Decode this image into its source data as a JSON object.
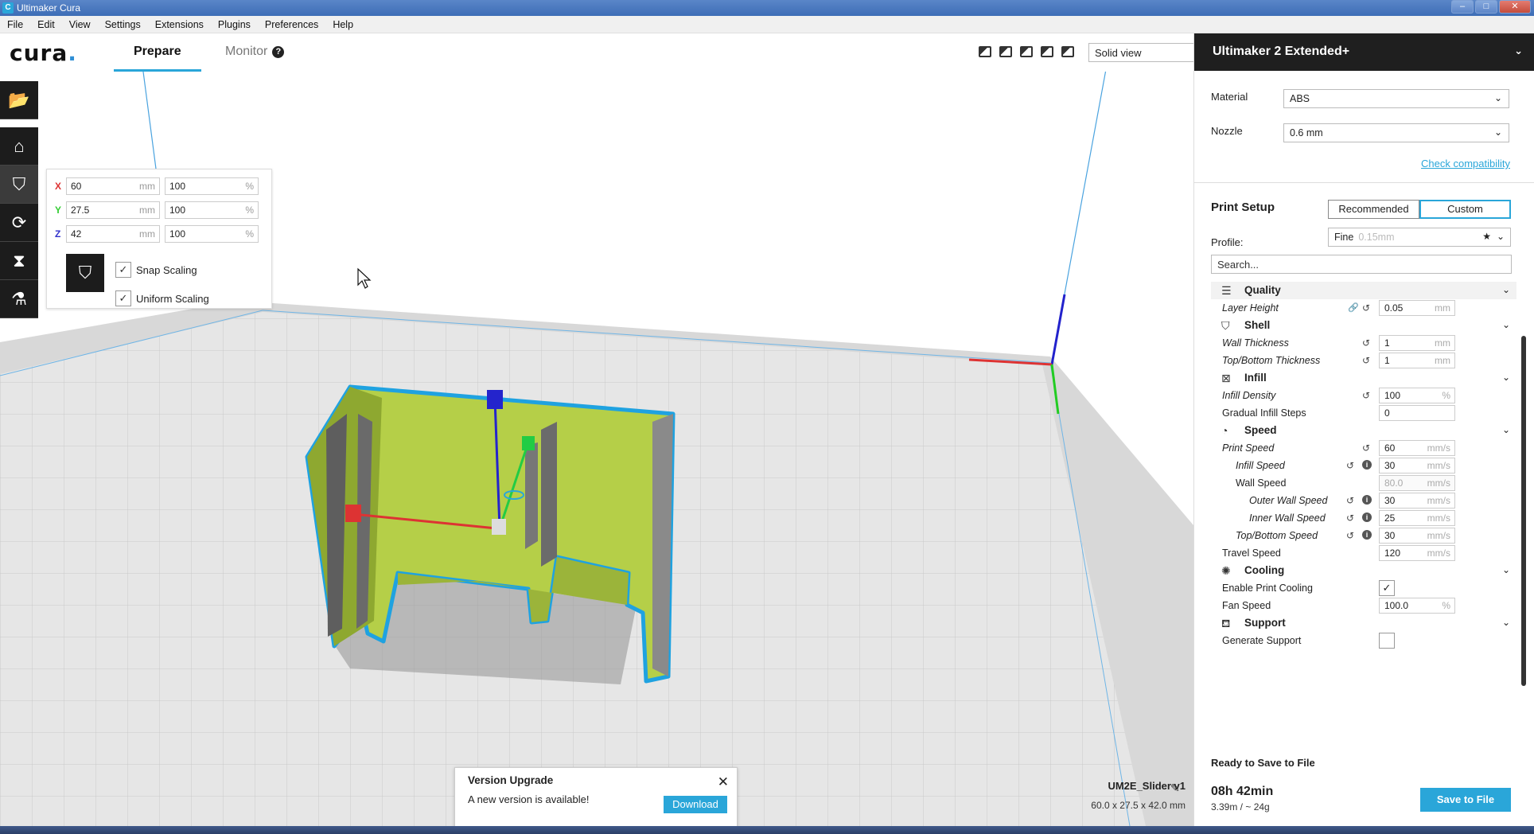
{
  "window": {
    "title": "Ultimaker Cura"
  },
  "menu": [
    "File",
    "Edit",
    "View",
    "Settings",
    "Extensions",
    "Plugins",
    "Preferences",
    "Help"
  ],
  "header": {
    "logo": "cura",
    "logo_dot": ".",
    "tabs": {
      "prepare": "Prepare",
      "monitor": "Monitor"
    },
    "monitor_help": "?",
    "view_mode": "Solid view"
  },
  "scale_panel": {
    "x": {
      "axis": "X",
      "mm": "60",
      "pct": "100"
    },
    "y": {
      "axis": "Y",
      "mm": "27.5",
      "pct": "100"
    },
    "z": {
      "axis": "Z",
      "mm": "42",
      "pct": "100"
    },
    "unit_mm": "mm",
    "unit_pct": "%",
    "snap_scaling": "Snap Scaling",
    "uniform_scaling": "Uniform Scaling"
  },
  "notification": {
    "title": "Version Upgrade",
    "message": "A new version is available!",
    "button": "Download"
  },
  "object": {
    "name": "UM2E_Slider v1",
    "dims": "60.0 x 27.5 x 42.0 mm"
  },
  "sidebar": {
    "printer": "Ultimaker 2 Extended+",
    "material_label": "Material",
    "material": "ABS",
    "nozzle_label": "Nozzle",
    "nozzle": "0.6 mm",
    "check_compat": "Check compatibility",
    "print_setup": "Print Setup",
    "mode_recommended": "Recommended",
    "mode_custom": "Custom",
    "profile_label": "Profile:",
    "profile": "Fine",
    "profile_sub": "0.15mm",
    "search_placeholder": "Search...",
    "settings": {
      "quality": "Quality",
      "layer_height": "Layer Height",
      "layer_height_val": "0.05",
      "shell": "Shell",
      "wall_thickness": "Wall Thickness",
      "wall_thickness_val": "1",
      "top_bottom_thickness": "Top/Bottom Thickness",
      "top_bottom_thickness_val": "1",
      "infill": "Infill",
      "infill_density": "Infill Density",
      "infill_density_val": "100",
      "gradual_infill": "Gradual Infill Steps",
      "gradual_infill_val": "0",
      "speed": "Speed",
      "print_speed": "Print Speed",
      "print_speed_val": "60",
      "infill_speed": "Infill Speed",
      "infill_speed_val": "30",
      "wall_speed": "Wall Speed",
      "wall_speed_val": "80.0",
      "outer_wall_speed": "Outer Wall Speed",
      "outer_wall_speed_val": "30",
      "inner_wall_speed": "Inner Wall Speed",
      "inner_wall_speed_val": "25",
      "top_bottom_speed": "Top/Bottom Speed",
      "top_bottom_speed_val": "30",
      "travel_speed": "Travel Speed",
      "travel_speed_val": "120",
      "cooling": "Cooling",
      "enable_cooling": "Enable Print Cooling",
      "fan_speed": "Fan Speed",
      "fan_speed_val": "100.0",
      "support": "Support",
      "generate_support": "Generate Support",
      "unit_mm": "mm",
      "unit_pct": "%",
      "unit_mms": "mm/s"
    },
    "ready": "Ready to Save to File",
    "time": "08h 42min",
    "usage": "3.39m / ~ 24g",
    "save": "Save to File"
  },
  "colors": {
    "accent": "#2aa6d9",
    "model": "#b6d24b",
    "toolbar": "#1c1c1c"
  }
}
